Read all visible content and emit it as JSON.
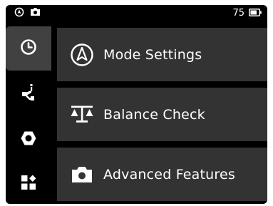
{
  "status_bar": {
    "left_icons": [
      "gimbal-mode-icon",
      "camera-icon"
    ],
    "battery_level": "75",
    "battery_icon": "battery-icon"
  },
  "sidebar": {
    "items": [
      {
        "icon": "clock-icon",
        "active": true
      },
      {
        "icon": "gimbal-arm-icon",
        "active": false
      },
      {
        "icon": "hexagon-icon",
        "active": false
      },
      {
        "icon": "apps-grid-icon",
        "active": false
      }
    ]
  },
  "menu": {
    "items": [
      {
        "label": "Mode Settings",
        "icon": "compass-mode-icon"
      },
      {
        "label": "Balance Check",
        "icon": "balance-scale-icon"
      },
      {
        "label": "Advanced Features",
        "icon": "camera-icon"
      }
    ]
  },
  "colors": {
    "background": "#000000",
    "panel": "#333333",
    "active_tab": "#414141",
    "text": "#ffffff"
  }
}
